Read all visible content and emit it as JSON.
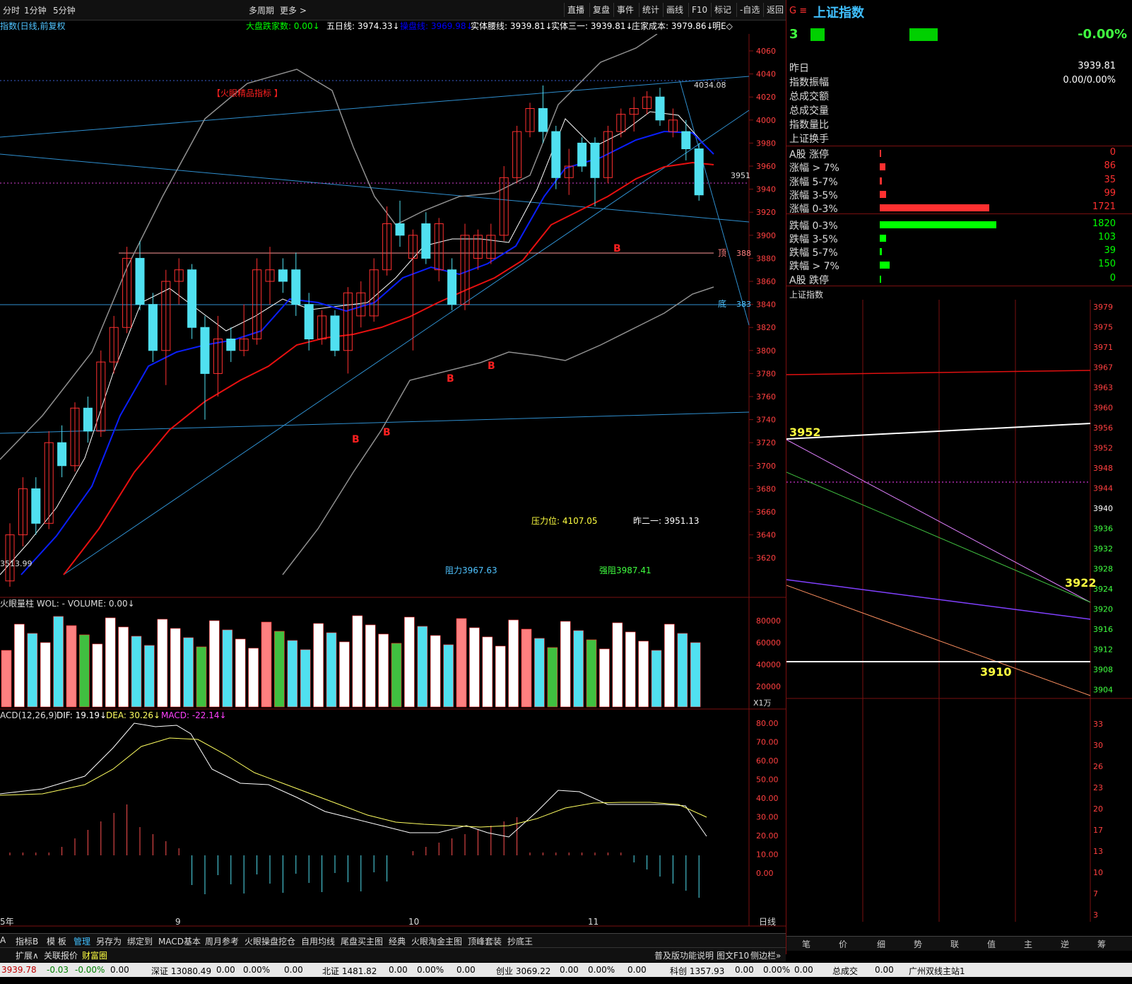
{
  "toolbar": {
    "left_tabs": [
      "分时",
      "1分钟",
      "5分钟"
    ],
    "center": [
      "多周期",
      "更多 >"
    ],
    "right_buttons": [
      "直播",
      "复盘",
      "事件",
      "统计",
      "画线",
      "F10",
      "标记",
      "-自选",
      "返回"
    ]
  },
  "chart_header": {
    "title": "指数(日线,前复权",
    "items": [
      {
        "label": "大盘跌家数: 0.00↓",
        "color": "#00ff00"
      },
      {
        "label": "五日线: 3974.33↓",
        "color": "#ffffff"
      },
      {
        "label": "操盘线: 3969.98↓",
        "color": "#0000ff"
      },
      {
        "label": "实体腰线: 3939.81↓",
        "color": "#ffffff"
      },
      {
        "label": "实体三一: 3939.81↓",
        "color": "#ffffff"
      },
      {
        "label": "庄家成本: 3979.86↓",
        "color": "#ffffff"
      },
      {
        "label": "明E◇",
        "color": "#ffffff"
      }
    ]
  },
  "main_chart": {
    "indicator_label": "【火眼精品指标 】",
    "price_axis": [
      "4060",
      "4040",
      "4020",
      "4000",
      "3980",
      "3960",
      "3940",
      "3920",
      "3900",
      "3880",
      "3860",
      "3840",
      "3820",
      "3800",
      "3780",
      "3760",
      "3740",
      "3720",
      "3700",
      "3680",
      "3660",
      "3640",
      "3620"
    ],
    "annotations": {
      "high": "4034.08",
      "level_3951": "3951",
      "top_label": "顶",
      "top_value": "388",
      "bottom_label": "底",
      "bottom_value": "383",
      "low": "3513.99",
      "pressure": "压力位: 4107.05",
      "prev": "昨二一: 3951.13",
      "resist": "阻力3967.63",
      "strong": "强阻3987.41",
      "buy_marker": "B"
    }
  },
  "volume_panel": {
    "label": "火眼量柱  WOL: - VOLUME: 0.00↓",
    "axis": [
      "80000",
      "60000",
      "40000",
      "20000"
    ],
    "unit": "X1万"
  },
  "macd_panel": {
    "label_prefix": "ACD(12,26,9)",
    "dif": "DIF: 19.19↓",
    "dea": "DEA: 30.26↓",
    "macd": "MACD: -22.14↓",
    "axis": [
      "80.00",
      "70.00",
      "60.00",
      "50.00",
      "40.00",
      "30.00",
      "20.00",
      "10.00",
      "0.00"
    ]
  },
  "time_axis": {
    "labels": [
      "5年",
      "9",
      "10",
      "11"
    ],
    "period": "日线"
  },
  "right_panel": {
    "title": "上证指数",
    "code_prefix": "G ≡",
    "price_short": "3",
    "change_pct": "-0.00%",
    "rows": [
      {
        "label": "昨日",
        "value": "3939.81"
      },
      {
        "label": "指数振幅",
        "value": "0.00/0.00%"
      },
      {
        "label": "总成交额",
        "value": ""
      },
      {
        "label": "总成交量",
        "value": ""
      },
      {
        "label": "指数量比",
        "value": ""
      },
      {
        "label": "上证换手",
        "value": ""
      }
    ],
    "breadth": [
      {
        "label": "A股 涨停",
        "value": "0",
        "color": "#ff3030",
        "ratio": 0.0
      },
      {
        "label": "涨幅 > 7%",
        "value": "86",
        "color": "#ff3030",
        "ratio": 0.05
      },
      {
        "label": "涨幅 5-7%",
        "value": "35",
        "color": "#ff3030",
        "ratio": 0.02
      },
      {
        "label": "涨幅 3-5%",
        "value": "99",
        "color": "#ff3030",
        "ratio": 0.055
      },
      {
        "label": "涨幅 0-3%",
        "value": "1721",
        "color": "#ff3030",
        "ratio": 0.94
      },
      {
        "label": "跌幅 0-3%",
        "value": "1820",
        "color": "#00ff00",
        "ratio": 1.0
      },
      {
        "label": "跌幅 3-5%",
        "value": "103",
        "color": "#00ff00",
        "ratio": 0.057
      },
      {
        "label": "跌幅 5-7%",
        "value": "39",
        "color": "#00ff00",
        "ratio": 0.02
      },
      {
        "label": "跌幅 > 7%",
        "value": "150",
        "color": "#00ff00",
        "ratio": 0.082
      },
      {
        "label": "A股 跌停",
        "value": "0",
        "color": "#00ff00",
        "ratio": 0.0
      }
    ],
    "mini_chart_title": "上证指数",
    "mini_axis": [
      "3979",
      "3975",
      "3971",
      "3967",
      "3963",
      "3960",
      "3956",
      "3952",
      "3948",
      "3944",
      "3940",
      "3936",
      "3932",
      "3928",
      "3924",
      "3920",
      "3916",
      "3912",
      "3908",
      "3904"
    ],
    "mini_axis2": [
      "33",
      "30",
      "26",
      "23",
      "20",
      "17",
      "13",
      "10",
      "7",
      "3"
    ],
    "mini_labels": {
      "a": "3952",
      "b": "3922",
      "c": "3910"
    },
    "bottom_tabs": [
      "笔",
      "价",
      "细",
      "势",
      "联",
      "值",
      "主",
      "逆",
      "筹"
    ]
  },
  "bottom_tabs": [
    "A",
    "指标B",
    "模 板",
    "管理",
    "另存为",
    "绑定到",
    "MACD基本",
    "周月参考",
    "火眼操盘挖仓",
    "自用均线",
    "尾盘买主图",
    "经典",
    "火眼淘金主图",
    "顶峰套装",
    "抄底王"
  ],
  "bottom_right": [
    "普及版功能说明",
    "图文F10",
    "侧边栏»"
  ],
  "bottom_row2": [
    "扩展∧",
    "关联报价",
    "财富圈"
  ],
  "status_bar": [
    {
      "text": "3939.78",
      "color": "#c00000"
    },
    {
      "text": "-0.03",
      "color": "#008000"
    },
    {
      "text": "-0.00%",
      "color": "#008000"
    },
    {
      "text": "0.00",
      "color": "#000"
    },
    {
      "text": "深证 13080.49",
      "color": "#000"
    },
    {
      "text": "0.00",
      "color": "#000"
    },
    {
      "text": "0.00%",
      "color": "#000"
    },
    {
      "text": "0.00",
      "color": "#000"
    },
    {
      "text": "北证 1481.82",
      "color": "#000"
    },
    {
      "text": "0.00",
      "color": "#000"
    },
    {
      "text": "0.00%",
      "color": "#000"
    },
    {
      "text": "0.00",
      "color": "#000"
    },
    {
      "text": "创业 3069.22",
      "color": "#000"
    },
    {
      "text": "0.00",
      "color": "#000"
    },
    {
      "text": "0.00%",
      "color": "#000"
    },
    {
      "text": "0.00",
      "color": "#000"
    },
    {
      "text": "科创 1357.93",
      "color": "#000"
    },
    {
      "text": "0.00",
      "color": "#000"
    },
    {
      "text": "0.00%",
      "color": "#000"
    },
    {
      "text": "0.00",
      "color": "#000"
    },
    {
      "text": "总成交",
      "color": "#000"
    },
    {
      "text": "0.00",
      "color": "#000"
    },
    {
      "text": "广州双线主站1",
      "color": "#000"
    }
  ],
  "candles": [
    [
      3600,
      3640,
      3595,
      3650,
      1
    ],
    [
      3640,
      3680,
      3630,
      3690,
      1
    ],
    [
      3680,
      3650,
      3640,
      3690,
      0
    ],
    [
      3650,
      3720,
      3645,
      3730,
      1
    ],
    [
      3720,
      3700,
      3690,
      3735,
      0
    ],
    [
      3700,
      3750,
      3695,
      3755,
      1
    ],
    [
      3750,
      3730,
      3720,
      3760,
      0
    ],
    [
      3730,
      3790,
      3725,
      3800,
      1
    ],
    [
      3790,
      3820,
      3780,
      3830,
      1
    ],
    [
      3820,
      3880,
      3815,
      3890,
      1
    ],
    [
      3880,
      3840,
      3835,
      3895,
      0
    ],
    [
      3840,
      3800,
      3790,
      3850,
      0
    ],
    [
      3800,
      3860,
      3770,
      3870,
      1
    ],
    [
      3860,
      3870,
      3840,
      3880,
      1
    ],
    [
      3870,
      3820,
      3810,
      3875,
      0
    ],
    [
      3820,
      3780,
      3740,
      3830,
      0
    ],
    [
      3780,
      3810,
      3760,
      3830,
      1
    ],
    [
      3810,
      3800,
      3790,
      3820,
      0
    ],
    [
      3800,
      3810,
      3795,
      3840,
      1
    ],
    [
      3810,
      3870,
      3805,
      3880,
      1
    ],
    [
      3870,
      3860,
      3840,
      3890,
      1
    ],
    [
      3860,
      3870,
      3850,
      3880,
      0
    ],
    [
      3870,
      3840,
      3830,
      3885,
      0
    ],
    [
      3840,
      3810,
      3800,
      3850,
      0
    ],
    [
      3810,
      3830,
      3805,
      3835,
      1
    ],
    [
      3830,
      3800,
      3795,
      3835,
      0
    ],
    [
      3800,
      3850,
      3780,
      3855,
      1
    ],
    [
      3850,
      3830,
      3820,
      3860,
      1
    ],
    [
      3830,
      3870,
      3825,
      3880,
      1
    ],
    [
      3870,
      3910,
      3865,
      3925,
      1
    ],
    [
      3910,
      3900,
      3890,
      3930,
      0
    ],
    [
      3900,
      3880,
      3800,
      3905,
      1
    ],
    [
      3880,
      3910,
      3875,
      3920,
      0
    ],
    [
      3910,
      3870,
      3860,
      3915,
      1
    ],
    [
      3870,
      3840,
      3835,
      3880,
      0
    ],
    [
      3840,
      3900,
      3835,
      3910,
      1
    ],
    [
      3900,
      3880,
      3870,
      3905,
      1
    ],
    [
      3880,
      3900,
      3875,
      3910,
      1
    ],
    [
      3900,
      3950,
      3895,
      3960,
      1
    ],
    [
      3950,
      3990,
      3945,
      3995,
      1
    ],
    [
      3990,
      4010,
      3985,
      4015,
      1
    ],
    [
      4010,
      3990,
      3980,
      4030,
      0
    ],
    [
      3990,
      3950,
      3940,
      3995,
      0
    ],
    [
      3950,
      3960,
      3935,
      3975,
      1
    ],
    [
      3960,
      3980,
      3955,
      3985,
      0
    ],
    [
      3980,
      3950,
      3925,
      3985,
      0
    ],
    [
      3950,
      3990,
      3945,
      3995,
      1
    ],
    [
      3990,
      4005,
      3985,
      4010,
      1
    ],
    [
      4005,
      4010,
      3990,
      4020,
      1
    ],
    [
      4010,
      4020,
      4005,
      4025,
      1
    ],
    [
      4020,
      4000,
      3995,
      4028,
      0
    ],
    [
      4000,
      3990,
      3985,
      4010,
      1
    ],
    [
      3990,
      3975,
      3965,
      4000,
      0
    ],
    [
      3975,
      3935,
      3930,
      3980,
      0
    ]
  ]
}
